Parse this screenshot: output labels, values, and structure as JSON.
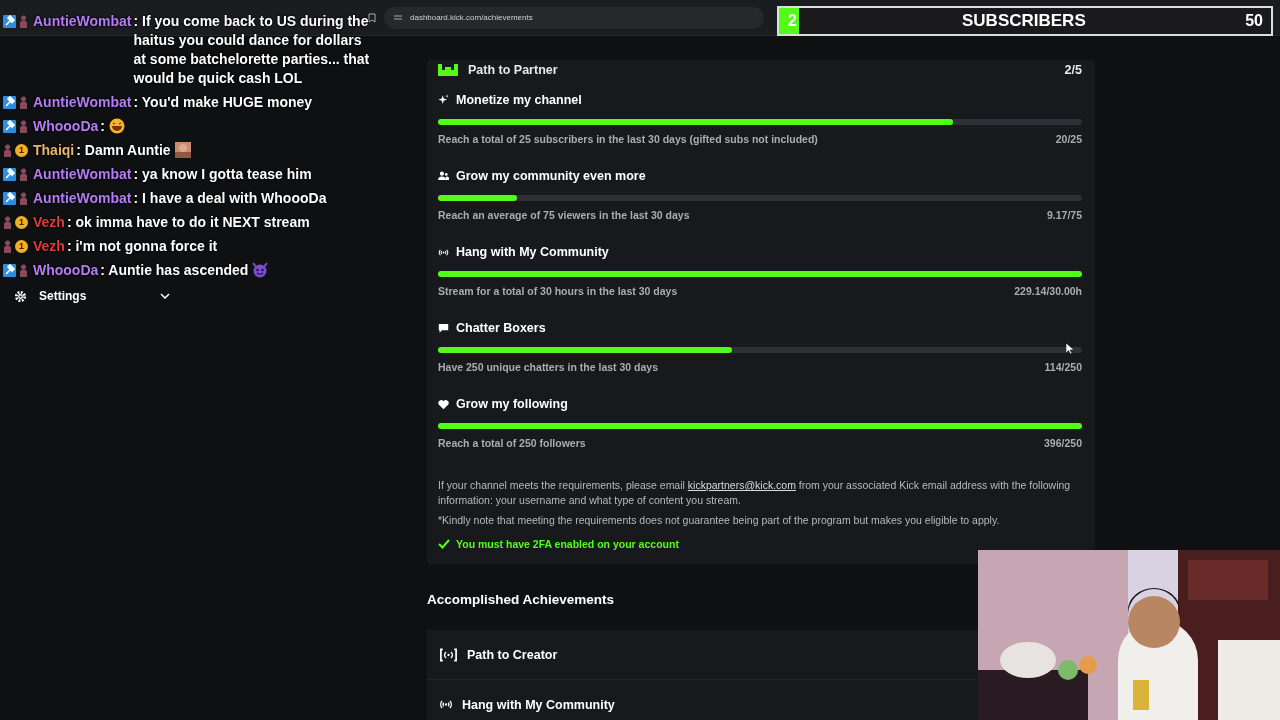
{
  "browser": {
    "url": "dashboard.kick.com/achievements"
  },
  "sidebar": {
    "items": [
      {
        "label": "Settings",
        "expandable": true
      }
    ]
  },
  "partner_path": {
    "title": "Path to Partner",
    "count": "2/5",
    "goals": [
      {
        "title": "Monetize my channel",
        "level": 0.8,
        "description": "Reach a total of 25 subscribers in the last 30 days (gifted subs not included)",
        "reading": "20/25"
      },
      {
        "title": "Grow my community even more",
        "level": 0.122,
        "description": "Reach an average of 75 viewers in the last 30 days",
        "reading": "9.17/75"
      },
      {
        "title": "Hang with My Community",
        "level": 1,
        "description": "Stream for a total of 30 hours in the last 30 days",
        "reading": "229.14/30.00h"
      },
      {
        "title": "Chatter Boxers",
        "level": 0.456,
        "description": "Have 250 unique chatters in the last 30 days",
        "reading": "114/250"
      },
      {
        "title": "Grow my following",
        "level": 1,
        "description": "Reach a total of 250 followers",
        "reading": "396/250"
      }
    ],
    "note_before": "If your channel meets the requirements, please email",
    "email": "kickpartners@kick.com",
    "note_after": "from your associated Kick email address with the following information: your username and what type of content you stream.",
    "disclaimer": "*Kindly note that meeting the requirements does not guarantee being part of the program but makes you eligible to apply.",
    "requirement": {
      "text": "You must have 2FA enabled on your account",
      "met": true
    }
  },
  "accomplished": {
    "heading": "Accomplished Achievements",
    "items": [
      {
        "title": "Path to Creator"
      },
      {
        "title": "Hang with My Community"
      }
    ]
  },
  "chat": {
    "messages": [
      {
        "kind": "moderator",
        "user": "AuntieWombat",
        "color": "#b57cf5",
        "text": ": If you come back to US during the haitus you could dance for dollars at some batchelorette parties... that would be quick cash LOL"
      },
      {
        "kind": "moderator",
        "user": "AuntieWombat",
        "color": "#b57cf5",
        "text": ": You'd make HUGE money"
      },
      {
        "kind": "moderator",
        "user": "WhoooDa",
        "color": "#b57cf5",
        "text": ":",
        "emote": true
      },
      {
        "kind": "gifter",
        "user": "Thaiqi",
        "color": "#e8b86a",
        "gifter_label": "1",
        "text": ": Damn Auntie",
        "emote": true
      },
      {
        "kind": "moderator",
        "user": "AuntieWombat",
        "color": "#b57cf5",
        "text": ": ya know I gotta tease him"
      },
      {
        "kind": "moderator",
        "user": "AuntieWombat",
        "color": "#b57cf5",
        "text": ": I have a deal with WhoooDa"
      },
      {
        "kind": "gifter",
        "user": "Vezh",
        "color": "#e03a3a",
        "gifter_label": "1",
        "text": ": ok imma have to do it NEXT stream"
      },
      {
        "kind": "gifter",
        "user": "Vezh",
        "color": "#e03a3a",
        "gifter_label": "1",
        "text": ": i'm not gonna force it"
      },
      {
        "kind": "moderator",
        "user": "WhoooDa",
        "color": "#b57cf5",
        "text": ": Auntie has ascended",
        "emote": true
      }
    ]
  },
  "sub_goal": {
    "current": "2",
    "label": "SUBSCRIBERS",
    "target": "50",
    "level": 0.04
  }
}
